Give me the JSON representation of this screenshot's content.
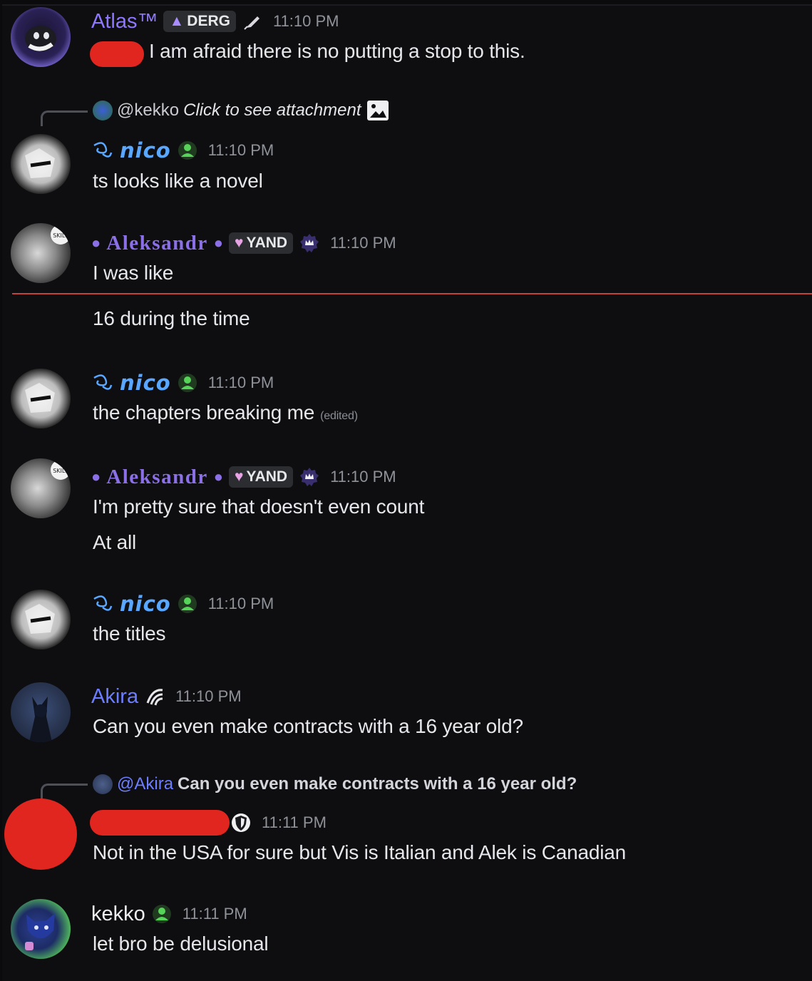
{
  "messages": {
    "atlas": {
      "username": "Atlas™",
      "tag": "DERG",
      "time": "11:10 PM",
      "text": "I am afraid there is no putting a stop to this."
    },
    "nico1": {
      "reply_user": "@kekko",
      "reply_text": "Click to see attachment",
      "username": "nico",
      "time": "11:10 PM",
      "text": "ts looks like a novel"
    },
    "alek1": {
      "username": "Aleksandr",
      "tag": "YAND",
      "time": "11:10 PM",
      "text": "I was like",
      "text2": "16 during the time"
    },
    "nico2": {
      "username": "nico",
      "time": "11:10 PM",
      "text": "the chapters breaking me",
      "edited": "(edited)"
    },
    "alek2": {
      "username": "Aleksandr",
      "tag": "YAND",
      "time": "11:10 PM",
      "text": "I'm pretty sure that doesn't even count",
      "text2": "At all"
    },
    "nico3": {
      "username": "nico",
      "time": "11:10 PM",
      "text": "the titles"
    },
    "akira": {
      "username": "Akira",
      "time": "11:10 PM",
      "text": "Can you even make contracts with a 16 year old?"
    },
    "redacted": {
      "reply_user": "@Akira",
      "reply_text": "Can you even make contracts with a 16 year old?",
      "time": "11:11 PM",
      "text": "Not in the USA for sure but Vis is Italian and Alek is Canadian"
    },
    "kekko": {
      "username": "kekko",
      "time": "11:11 PM",
      "text": "let bro be delusional"
    }
  },
  "colors": {
    "background": "#0e0e11",
    "new_messages_divider": "#c4423c",
    "redaction": "#e0261f"
  }
}
